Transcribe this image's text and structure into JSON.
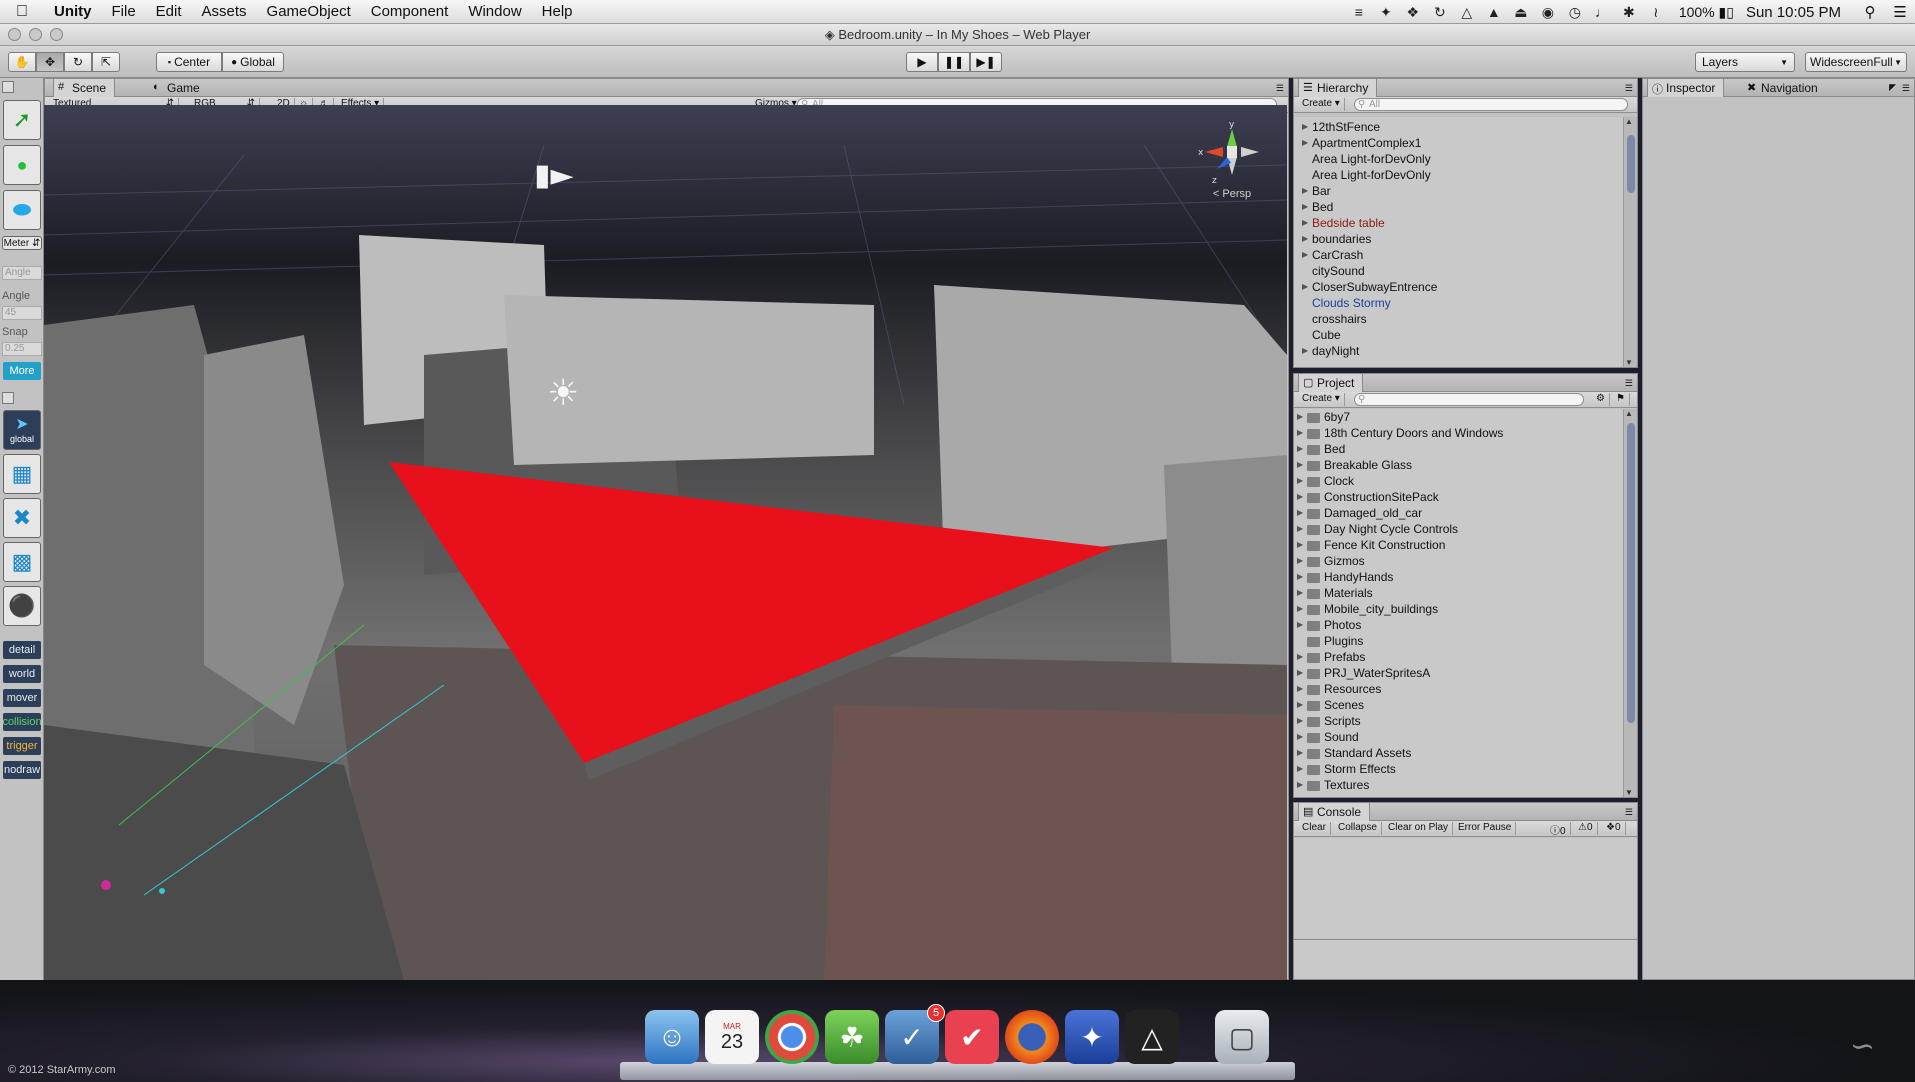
{
  "menubar": {
    "apple": "",
    "items": [
      "Unity",
      "File",
      "Edit",
      "Assets",
      "GameObject",
      "Component",
      "Window",
      "Help"
    ],
    "battery": "100%",
    "clock": "Sun 10:05 PM"
  },
  "window": {
    "title": "Bedroom.unity – In My Shoes – Web Player"
  },
  "toolbar": {
    "pivot": "Center",
    "rotation": "Global",
    "layers": "Layers",
    "layout": "WidescreenFull"
  },
  "leftstrip": {
    "unit": "Meter",
    "angle_field": "Angle",
    "angle_label": "Angle",
    "angle_value": "45",
    "snap_label": "Snap",
    "snap_value": "0.25",
    "more": "More",
    "global": "global",
    "tags": [
      "detail",
      "world",
      "mover",
      "collision",
      "trigger",
      "nodraw"
    ]
  },
  "scene": {
    "tabs": [
      "Scene",
      "Game"
    ],
    "shading": "Textured",
    "channel": "RGB",
    "mode_2d": "2D",
    "effects": "Effects",
    "gizmos": "Gizmos",
    "search_placeholder": "All",
    "persp": "Persp"
  },
  "hierarchy": {
    "title": "Hierarchy",
    "create": "Create",
    "search_placeholder": "All",
    "items": [
      {
        "label": "12thStFence",
        "arrow": true,
        "color": "#111111"
      },
      {
        "label": "ApartmentComplex1",
        "arrow": true,
        "color": "#111111"
      },
      {
        "label": "Area Light-forDevOnly",
        "arrow": false,
        "color": "#111111"
      },
      {
        "label": "Area Light-forDevOnly",
        "arrow": false,
        "color": "#111111"
      },
      {
        "label": "Bar",
        "arrow": true,
        "color": "#111111"
      },
      {
        "label": "Bed",
        "arrow": true,
        "color": "#111111"
      },
      {
        "label": "Bedside table",
        "arrow": true,
        "color": "#8b1a1a"
      },
      {
        "label": "boundaries",
        "arrow": true,
        "color": "#111111"
      },
      {
        "label": "CarCrash",
        "arrow": true,
        "color": "#111111"
      },
      {
        "label": "citySound",
        "arrow": false,
        "color": "#111111"
      },
      {
        "label": "CloserSubwayEntrence",
        "arrow": true,
        "color": "#111111"
      },
      {
        "label": "Clouds Stormy",
        "arrow": false,
        "color": "#1f3f99"
      },
      {
        "label": "crosshairs",
        "arrow": false,
        "color": "#111111"
      },
      {
        "label": "Cube",
        "arrow": false,
        "color": "#111111"
      },
      {
        "label": "dayNight",
        "arrow": true,
        "color": "#111111"
      }
    ]
  },
  "inspector": {
    "tabs": [
      "Inspector",
      "Navigation"
    ]
  },
  "project": {
    "title": "Project",
    "create": "Create",
    "folders": [
      "6by7",
      "18th Century Doors and Windows",
      "Bed",
      "Breakable Glass",
      "Clock",
      "ConstructionSitePack",
      "Damaged_old_car",
      "Day Night Cycle Controls",
      "Fence Kit Construction",
      "Gizmos",
      "HandyHands",
      "Materials",
      "Mobile_city_buildings",
      "Photos",
      "Plugins",
      "Prefabs",
      "PRJ_WaterSpritesA",
      "Resources",
      "Scenes",
      "Scripts",
      "Sound",
      "Standard Assets",
      "Storm Effects",
      "Textures"
    ]
  },
  "console": {
    "title": "Console",
    "buttons": [
      "Clear",
      "Collapse",
      "Clear on Play",
      "Error Pause"
    ],
    "counts": [
      "0",
      "0",
      "0"
    ]
  },
  "dock": {
    "calendar_month": "MAR",
    "calendar_day": "23",
    "badge": "5",
    "copyright": "© 2012 StarArmy.com"
  },
  "colors": {
    "selection_blue": "#2f6fb6",
    "triangle_red": "#e8101a",
    "tag_bg": "#2d3e58"
  }
}
